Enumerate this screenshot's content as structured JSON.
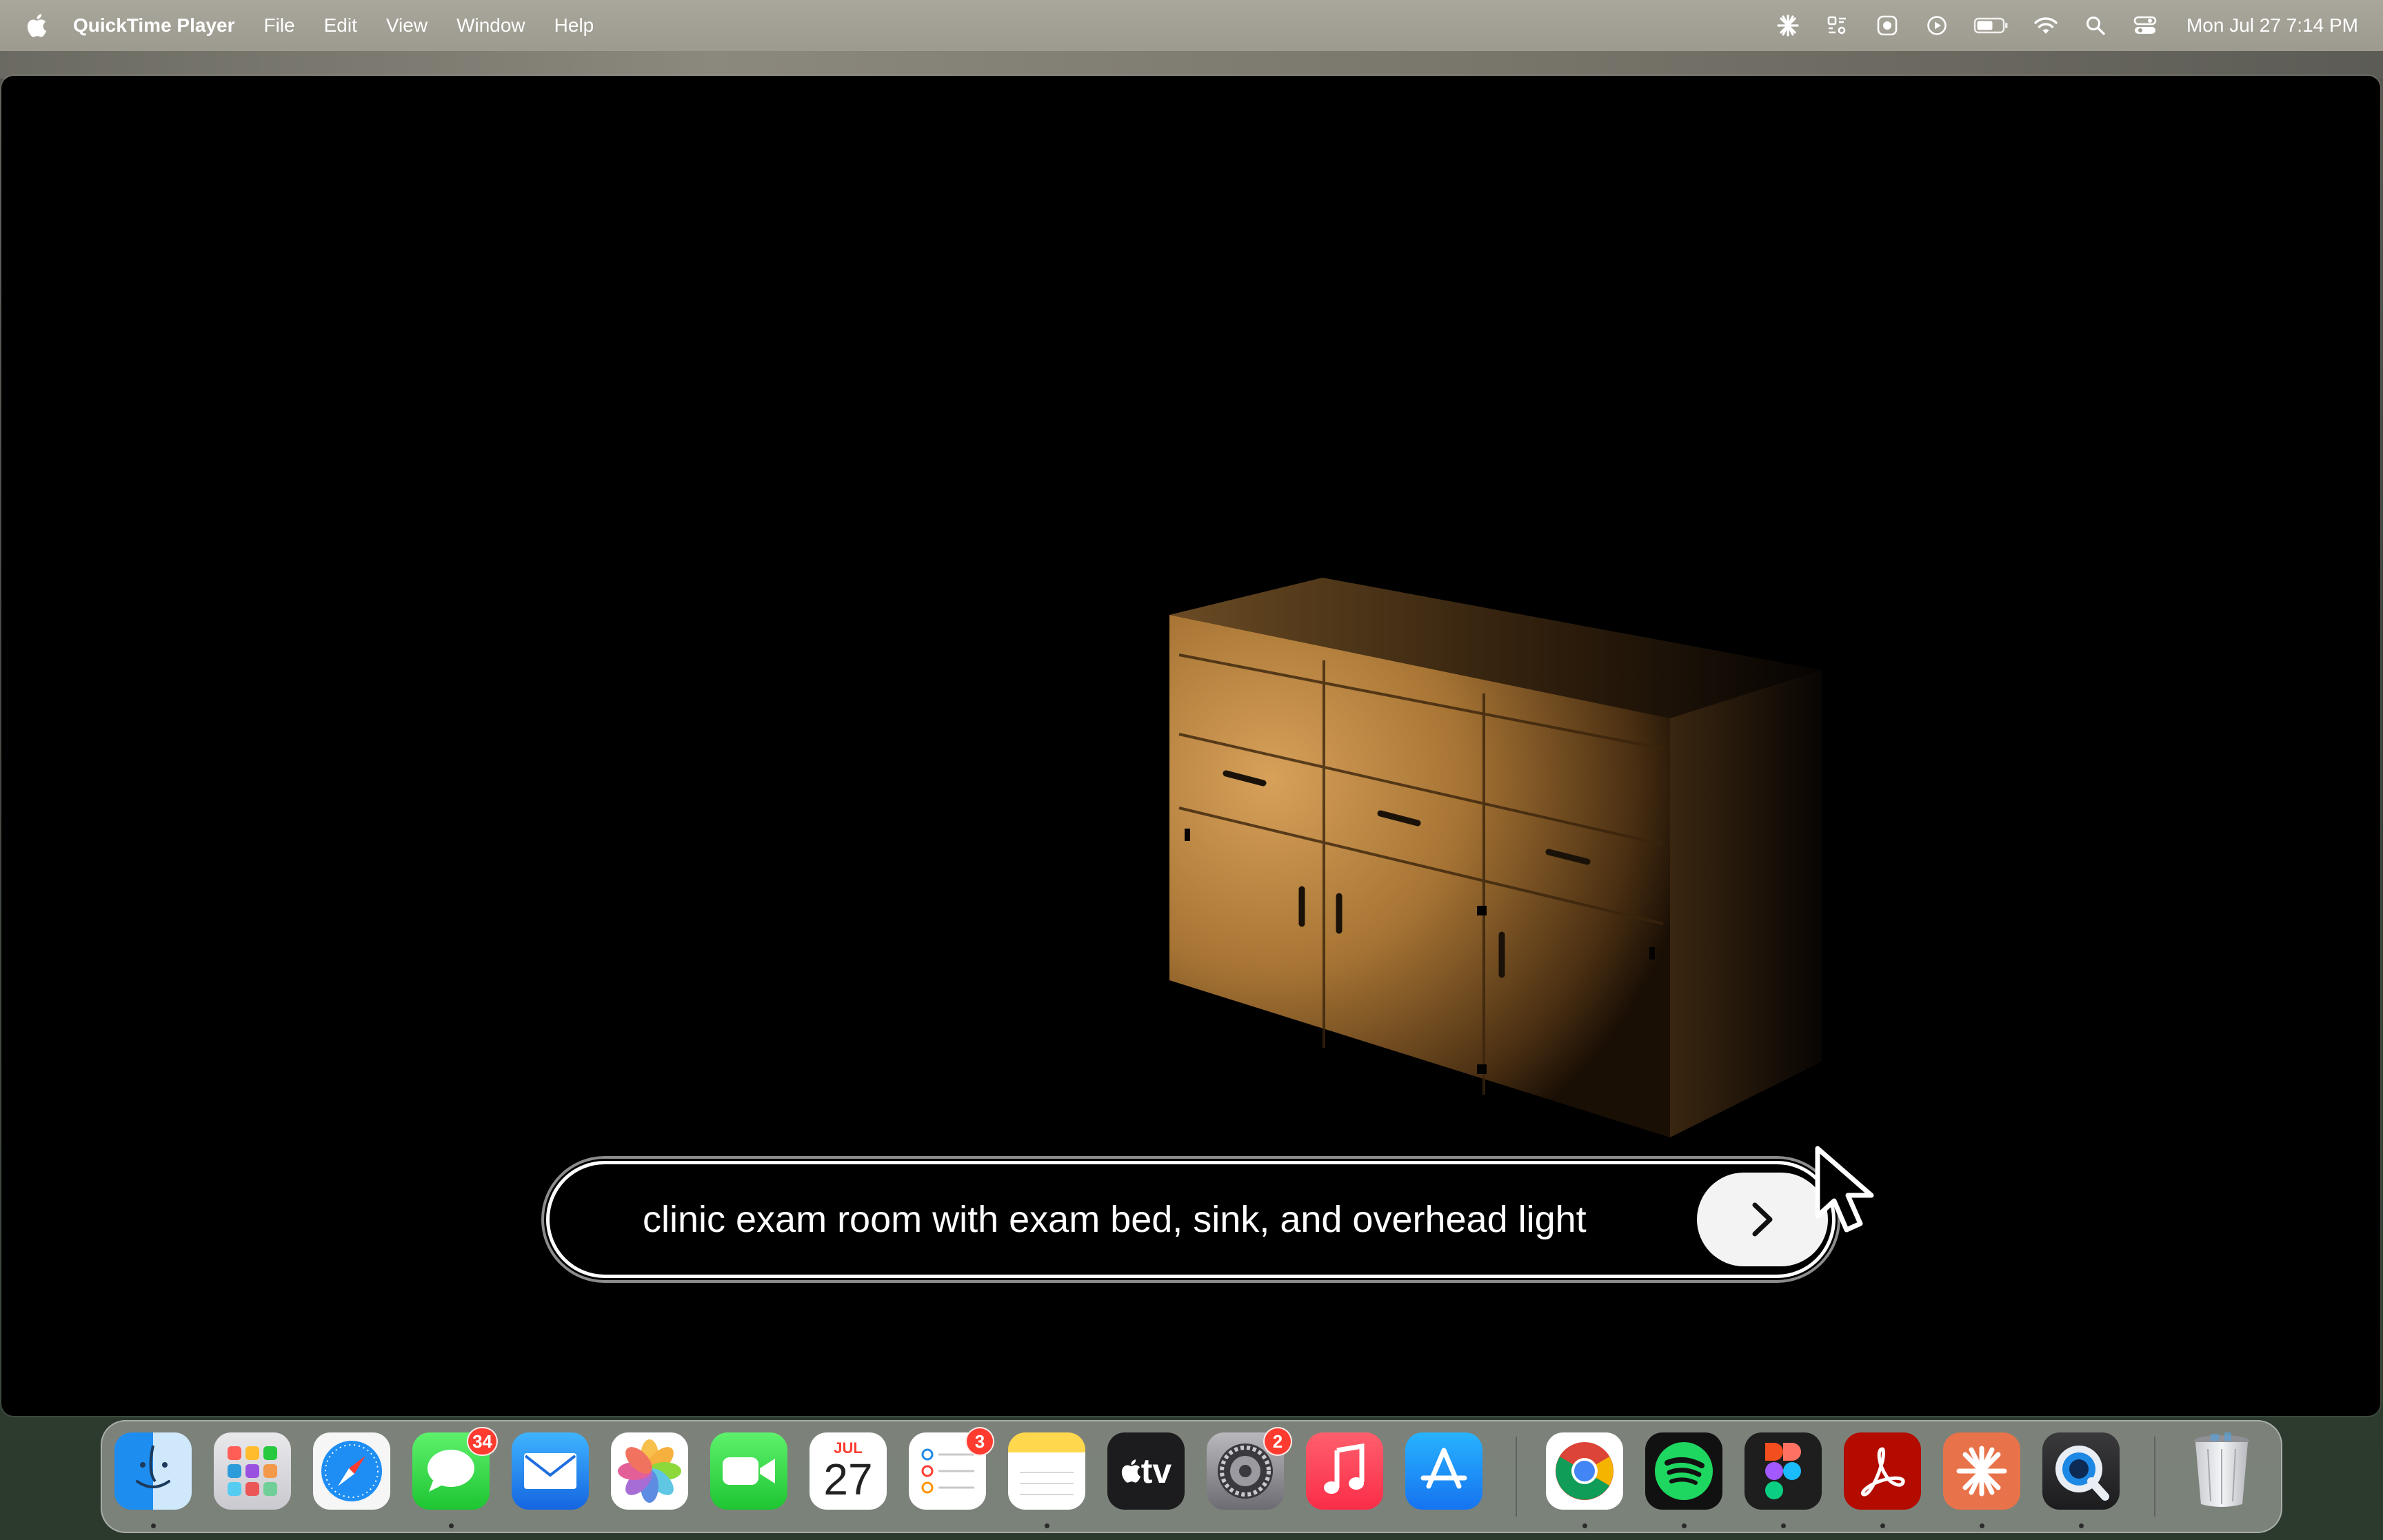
{
  "menubar": {
    "app_name": "QuickTime Player",
    "menus": [
      "File",
      "Edit",
      "View",
      "Window",
      "Help"
    ],
    "clock": "Mon Jul 27  7:14 PM",
    "status_icons": [
      "claude-icon",
      "focus-icon",
      "screen-record-icon",
      "play-icon",
      "battery-icon",
      "wifi-icon",
      "spotlight-search-icon",
      "control-center-icon"
    ]
  },
  "window": {
    "title": "QuickTime Player",
    "background": "#000000"
  },
  "prompt": {
    "text": "clinic exam room with exam bed, sink, and overhead light",
    "submit_icon": "chevron-right-icon"
  },
  "dock": {
    "items": [
      {
        "name": "Finder",
        "icon": "finder-icon",
        "running": true
      },
      {
        "name": "Launchpad",
        "icon": "launchpad-icon",
        "running": false
      },
      {
        "name": "Safari",
        "icon": "safari-icon",
        "running": false
      },
      {
        "name": "Messages",
        "icon": "messages-icon",
        "badge": "34",
        "running": true
      },
      {
        "name": "Mail",
        "icon": "mail-icon",
        "running": false
      },
      {
        "name": "Photos",
        "icon": "photos-icon",
        "running": false
      },
      {
        "name": "FaceTime",
        "icon": "facetime-icon",
        "running": false
      },
      {
        "name": "Calendar",
        "icon": "calendar-icon",
        "month": "JUL",
        "day": "27",
        "running": false
      },
      {
        "name": "Reminders",
        "icon": "reminders-icon",
        "badge": "3",
        "running": false
      },
      {
        "name": "Notes",
        "icon": "notes-icon",
        "running": true
      },
      {
        "name": "TV",
        "icon": "apple-tv-icon",
        "label": "tv",
        "running": false
      },
      {
        "name": "System Settings",
        "icon": "system-settings-icon",
        "badge": "2",
        "running": false
      },
      {
        "name": "Music",
        "icon": "music-icon",
        "running": false
      },
      {
        "name": "App Store",
        "icon": "app-store-icon",
        "running": false
      },
      {
        "name": "Google Chrome",
        "icon": "chrome-icon",
        "running": true
      },
      {
        "name": "Spotify",
        "icon": "spotify-icon",
        "running": true
      },
      {
        "name": "Figma",
        "icon": "figma-icon",
        "running": true
      },
      {
        "name": "Adobe Acrobat",
        "icon": "acrobat-icon",
        "running": true
      },
      {
        "name": "Claude",
        "icon": "claude-app-icon",
        "running": true
      },
      {
        "name": "QuickTime Player",
        "icon": "quicktime-icon",
        "running": true
      },
      {
        "name": "Trash",
        "icon": "trash-icon",
        "running": false
      }
    ]
  },
  "colors": {
    "menubar": "#a9a69b",
    "badge": "#ff3b30",
    "prompt_border": "#ffffff"
  }
}
